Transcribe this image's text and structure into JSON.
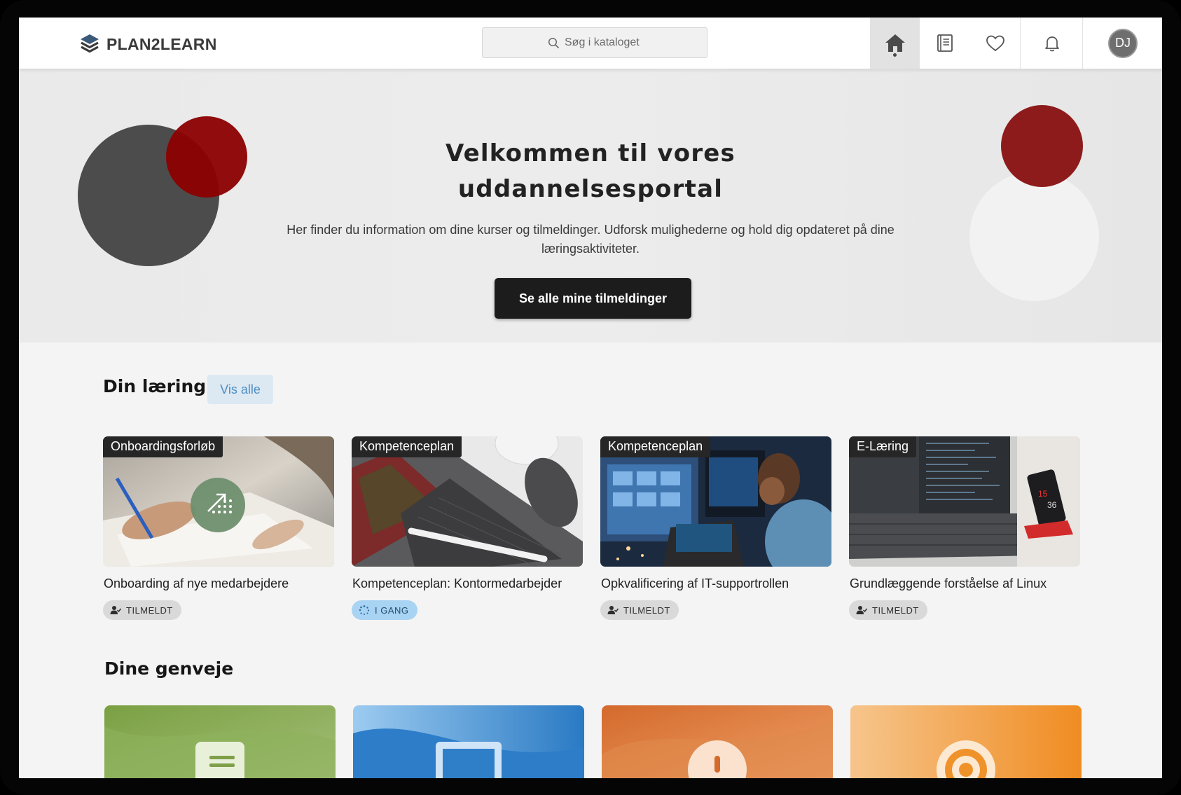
{
  "header": {
    "logo_text": "PLAN2LEARN",
    "search": {
      "placeholder": "Søg i kataloget"
    },
    "nav": [
      "home-icon",
      "book-icon",
      "heart-icon",
      "bell-icon"
    ],
    "avatar_initials": "DJ"
  },
  "hero": {
    "title": "Velkommen til vores uddannelsesportal",
    "subtitle": "Her finder du information om dine kurser og tilmeldinger. Udforsk mulighederne og hold dig opdateret på dine læringsaktiviteter.",
    "button_label": "Se alle mine tilmeldinger"
  },
  "learning": {
    "title": "Din læring",
    "view_all_label": "Vis alle",
    "cards": [
      {
        "tag": "Onboardingsforløb",
        "title": "Onboarding af nye medarbejdere",
        "status": "TILMELDT"
      },
      {
        "tag": "Kompetenceplan",
        "title": "Kompetenceplan: Kontormedarbejder",
        "status": "I GANG"
      },
      {
        "tag": "Kompetenceplan",
        "title": "Opkvalificering af IT-supportrollen",
        "status": "TILMELDT"
      },
      {
        "tag": "E-Læring",
        "title": "Grundlæggende forståelse af Linux",
        "status": "TILMELDT"
      }
    ]
  },
  "shortcuts": {
    "title": "Dine genveje",
    "tiles": [
      {
        "icon": "document-icon",
        "color": "#8fb05c"
      },
      {
        "icon": "laptop-icon",
        "color": "#2f7fc8"
      },
      {
        "icon": "alert-icon",
        "color": "#dd7a33"
      },
      {
        "icon": "target-icon",
        "color": "#f2992b"
      }
    ]
  },
  "colors": {
    "accent_red": "#8e1b1b",
    "dark_button": "#1c1c1c",
    "link_blue": "#4d8ec4"
  }
}
